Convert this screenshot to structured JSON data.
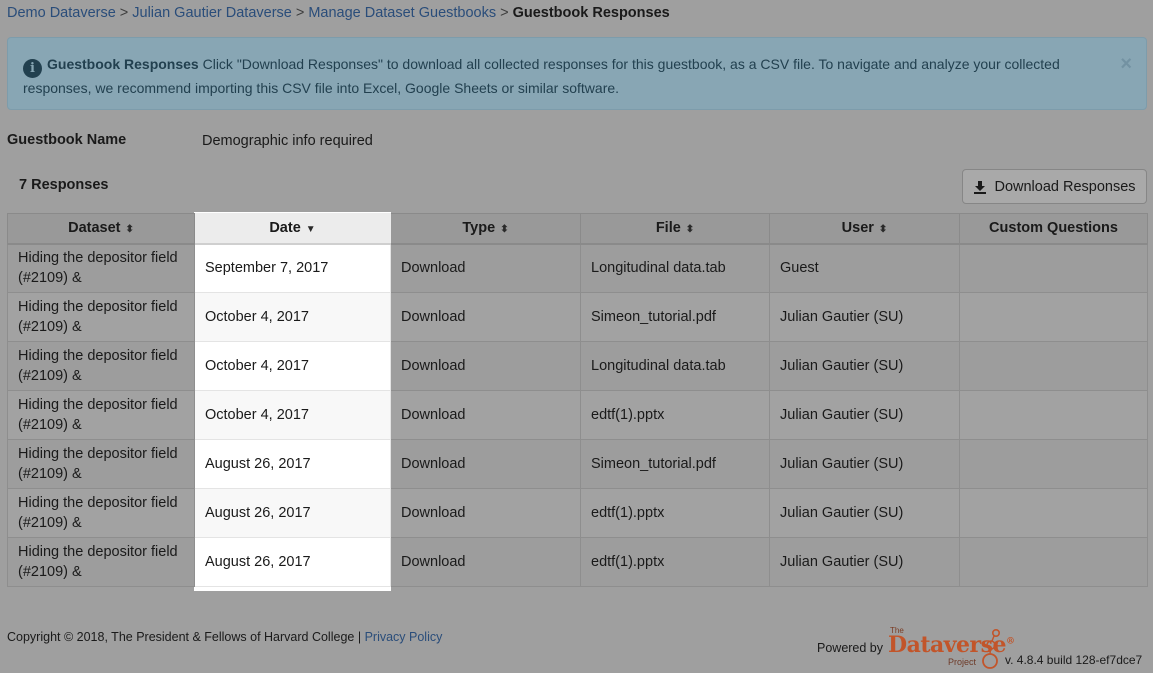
{
  "breadcrumb": {
    "items": [
      "Demo Dataverse",
      "Julian Gautier Dataverse",
      "Manage Dataset Guestbooks"
    ],
    "separator": ">",
    "current": "Guestbook Responses"
  },
  "alert": {
    "icon": "info-circle-icon",
    "title": "Guestbook Responses",
    "message": "Click \"Download Responses\" to download all collected responses for this guestbook, as a CSV file. To navigate and analyze your collected responses, we recommend importing this CSV file into Excel, Google Sheets or similar software.",
    "close": "×"
  },
  "guestbook": {
    "name_label": "Guestbook Name",
    "name_value": "Demographic info required"
  },
  "responses": {
    "count_label": "7 Responses",
    "download_label": "Download Responses"
  },
  "table": {
    "headers": {
      "dataset": "Dataset",
      "date": "Date",
      "type": "Type",
      "file": "File",
      "user": "User",
      "custom": "Custom Questions"
    },
    "sort_both": "⬍",
    "sort_down": "▼",
    "rows": [
      {
        "dataset_1": "Hiding the depositor field",
        "dataset_2": "(#2109) &",
        "date": "September 7, 2017",
        "type": "Download",
        "file": "Longitudinal data.tab",
        "user": "Guest",
        "custom": ""
      },
      {
        "dataset_1": "Hiding the depositor field",
        "dataset_2": "(#2109) &",
        "date": "October 4, 2017",
        "type": "Download",
        "file": "Simeon_tutorial.pdf",
        "user": "Julian Gautier (SU)",
        "custom": ""
      },
      {
        "dataset_1": "Hiding the depositor field",
        "dataset_2": "(#2109) &",
        "date": "October 4, 2017",
        "type": "Download",
        "file": "Longitudinal data.tab",
        "user": "Julian Gautier (SU)",
        "custom": ""
      },
      {
        "dataset_1": "Hiding the depositor field",
        "dataset_2": "(#2109) &",
        "date": "October 4, 2017",
        "type": "Download",
        "file": "edtf(1).pptx",
        "user": "Julian Gautier (SU)",
        "custom": ""
      },
      {
        "dataset_1": "Hiding the depositor field",
        "dataset_2": "(#2109) &",
        "date": "August 26, 2017",
        "type": "Download",
        "file": "Simeon_tutorial.pdf",
        "user": "Julian Gautier (SU)",
        "custom": ""
      },
      {
        "dataset_1": "Hiding the depositor field",
        "dataset_2": "(#2109) &",
        "date": "August 26, 2017",
        "type": "Download",
        "file": "edtf(1).pptx",
        "user": "Julian Gautier (SU)",
        "custom": ""
      },
      {
        "dataset_1": "Hiding the depositor field",
        "dataset_2": "(#2109) &",
        "date": "August 26, 2017",
        "type": "Download",
        "file": "edtf(1).pptx",
        "user": "Julian Gautier (SU)",
        "custom": ""
      }
    ]
  },
  "footer": {
    "copyright": "Copyright © 2018, The President & Fellows of Harvard College |",
    "privacy": "Privacy Policy",
    "powered_by": "Powered by",
    "logo_the": "The",
    "logo_name": "Dataverse",
    "logo_reg": "®",
    "logo_project": "Project",
    "version": "v. 4.8.4 build 128-ef7dce7"
  },
  "colors": {
    "overlay_bg": "#9f9f9f",
    "alert_bg": "#88a6b4",
    "link": "#2a4d7a",
    "logo": "#c2552a"
  }
}
